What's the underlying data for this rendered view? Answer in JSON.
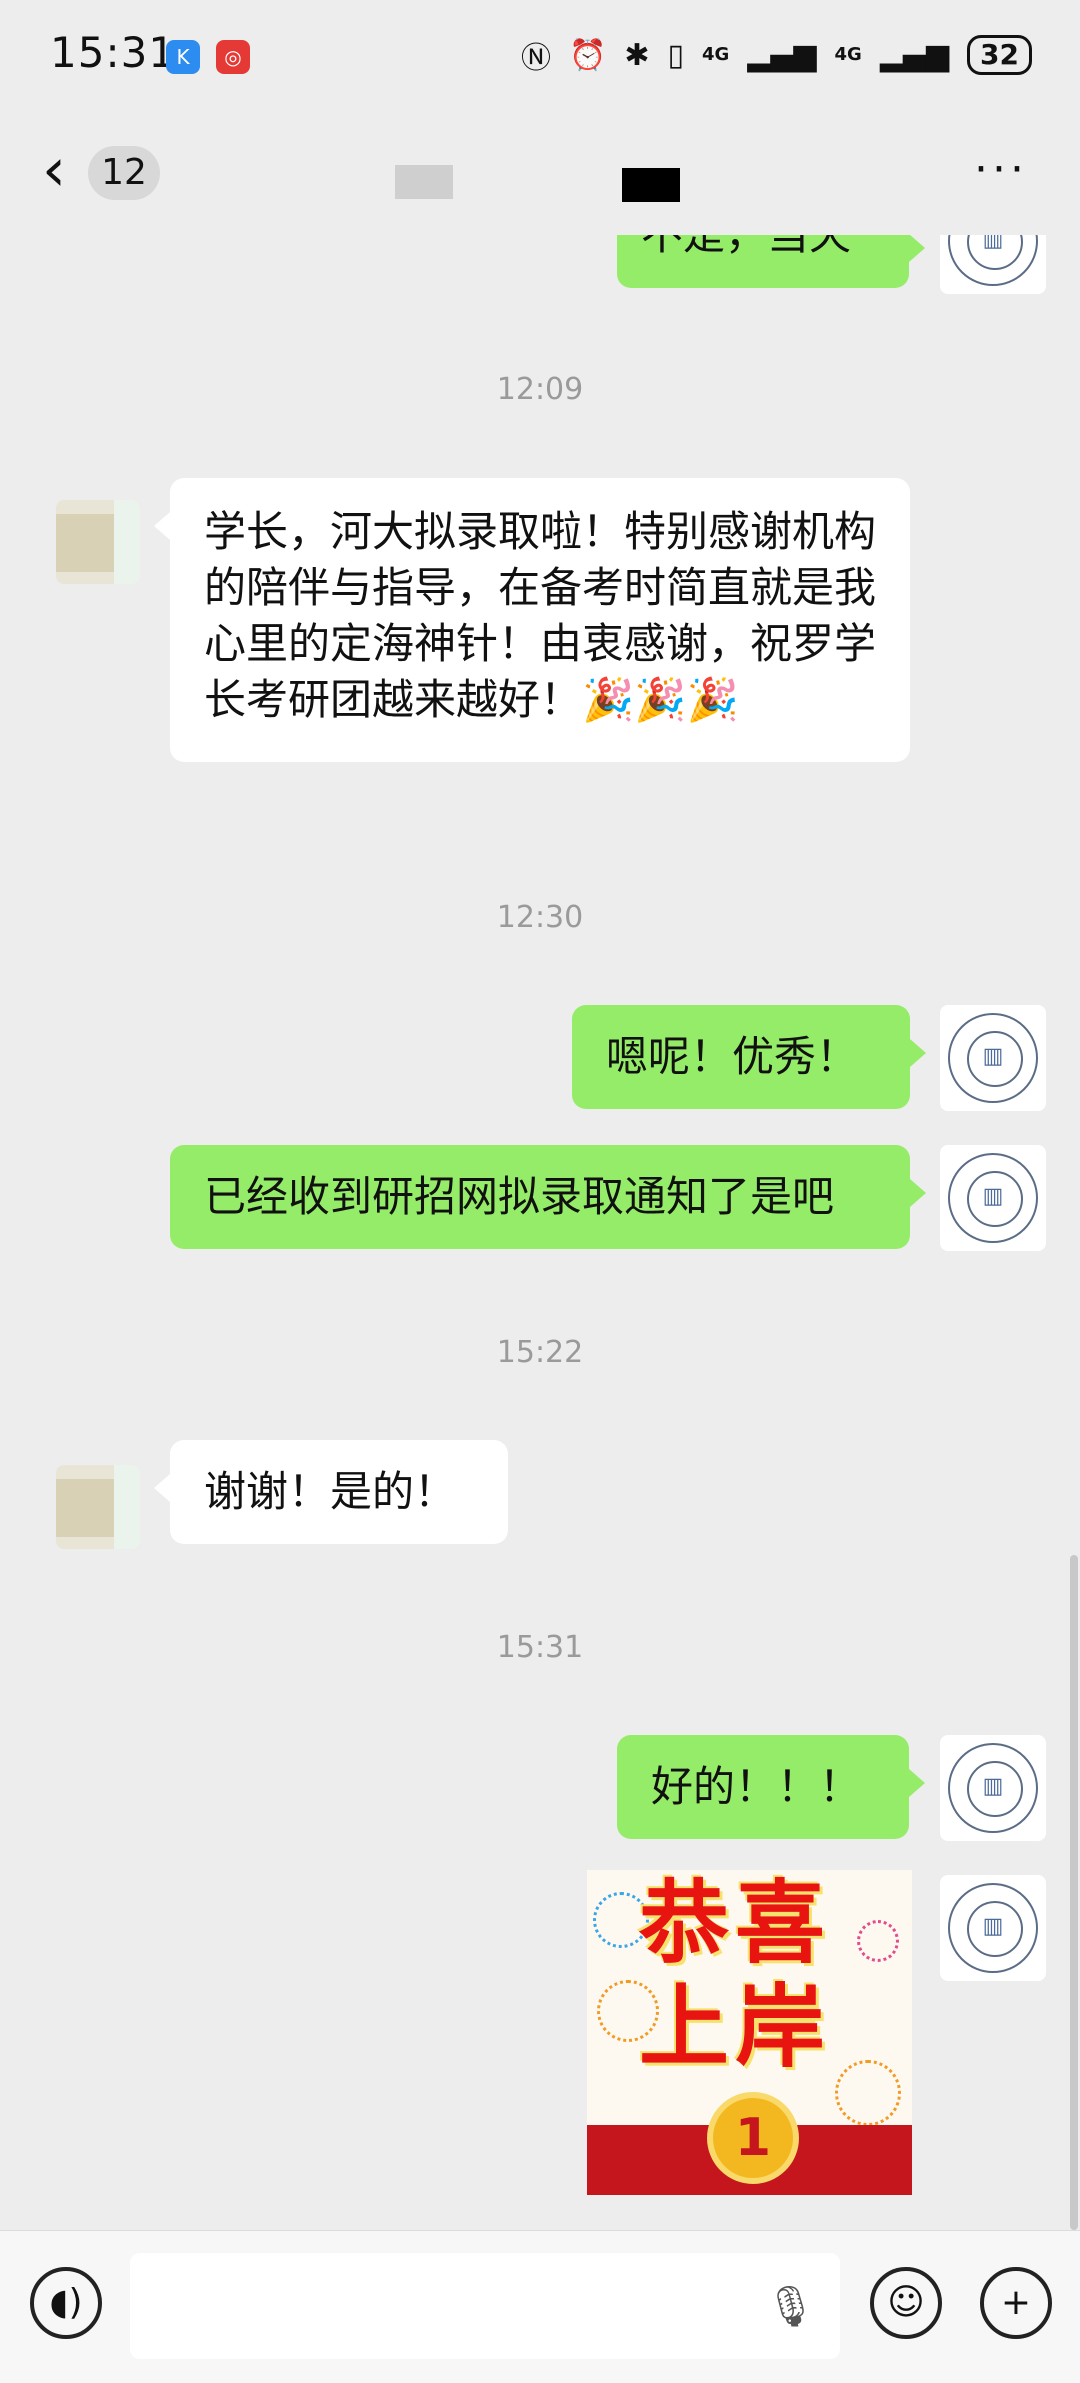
{
  "status_bar": {
    "time": "15:31",
    "network1": "4G",
    "network2": "4G",
    "battery": "32"
  },
  "header": {
    "back_icon": "chevron-left-icon",
    "unread_count": "12",
    "more_label": "···"
  },
  "chat": {
    "messages": [
      {
        "side": "out",
        "text": "不是，当天"
      },
      {
        "type": "timestamp",
        "text": "12:09"
      },
      {
        "side": "in",
        "text": "学长，河大拟录取啦！特别感谢机构的陪伴与指导，在备考时简直就是我心里的定海神针！由衷感谢，祝罗学长考研团越来越好！🎉🎉🎉"
      },
      {
        "type": "timestamp",
        "text": "12:30"
      },
      {
        "side": "out",
        "text": "嗯呢！优秀！"
      },
      {
        "side": "out",
        "text": "已经收到研招网拟录取通知了是吧"
      },
      {
        "type": "timestamp",
        "text": "15:22"
      },
      {
        "side": "in",
        "text": "谢谢！是的！"
      },
      {
        "type": "timestamp",
        "text": "15:31"
      },
      {
        "side": "out",
        "text": "好的！！！"
      },
      {
        "side": "out",
        "type": "sticker",
        "line1": "恭喜",
        "line2": "上岸",
        "medal": "1"
      }
    ]
  },
  "input_bar": {
    "voice_icon": "voice-icon",
    "mic_icon": "microphone-icon",
    "emoji_icon": "emoji-icon",
    "plus_icon": "plus-icon"
  },
  "colors": {
    "background": "#ededed",
    "outgoing_bubble": "#95ec69",
    "incoming_bubble": "#ffffff",
    "timestamp_text": "#9a9a9a"
  }
}
